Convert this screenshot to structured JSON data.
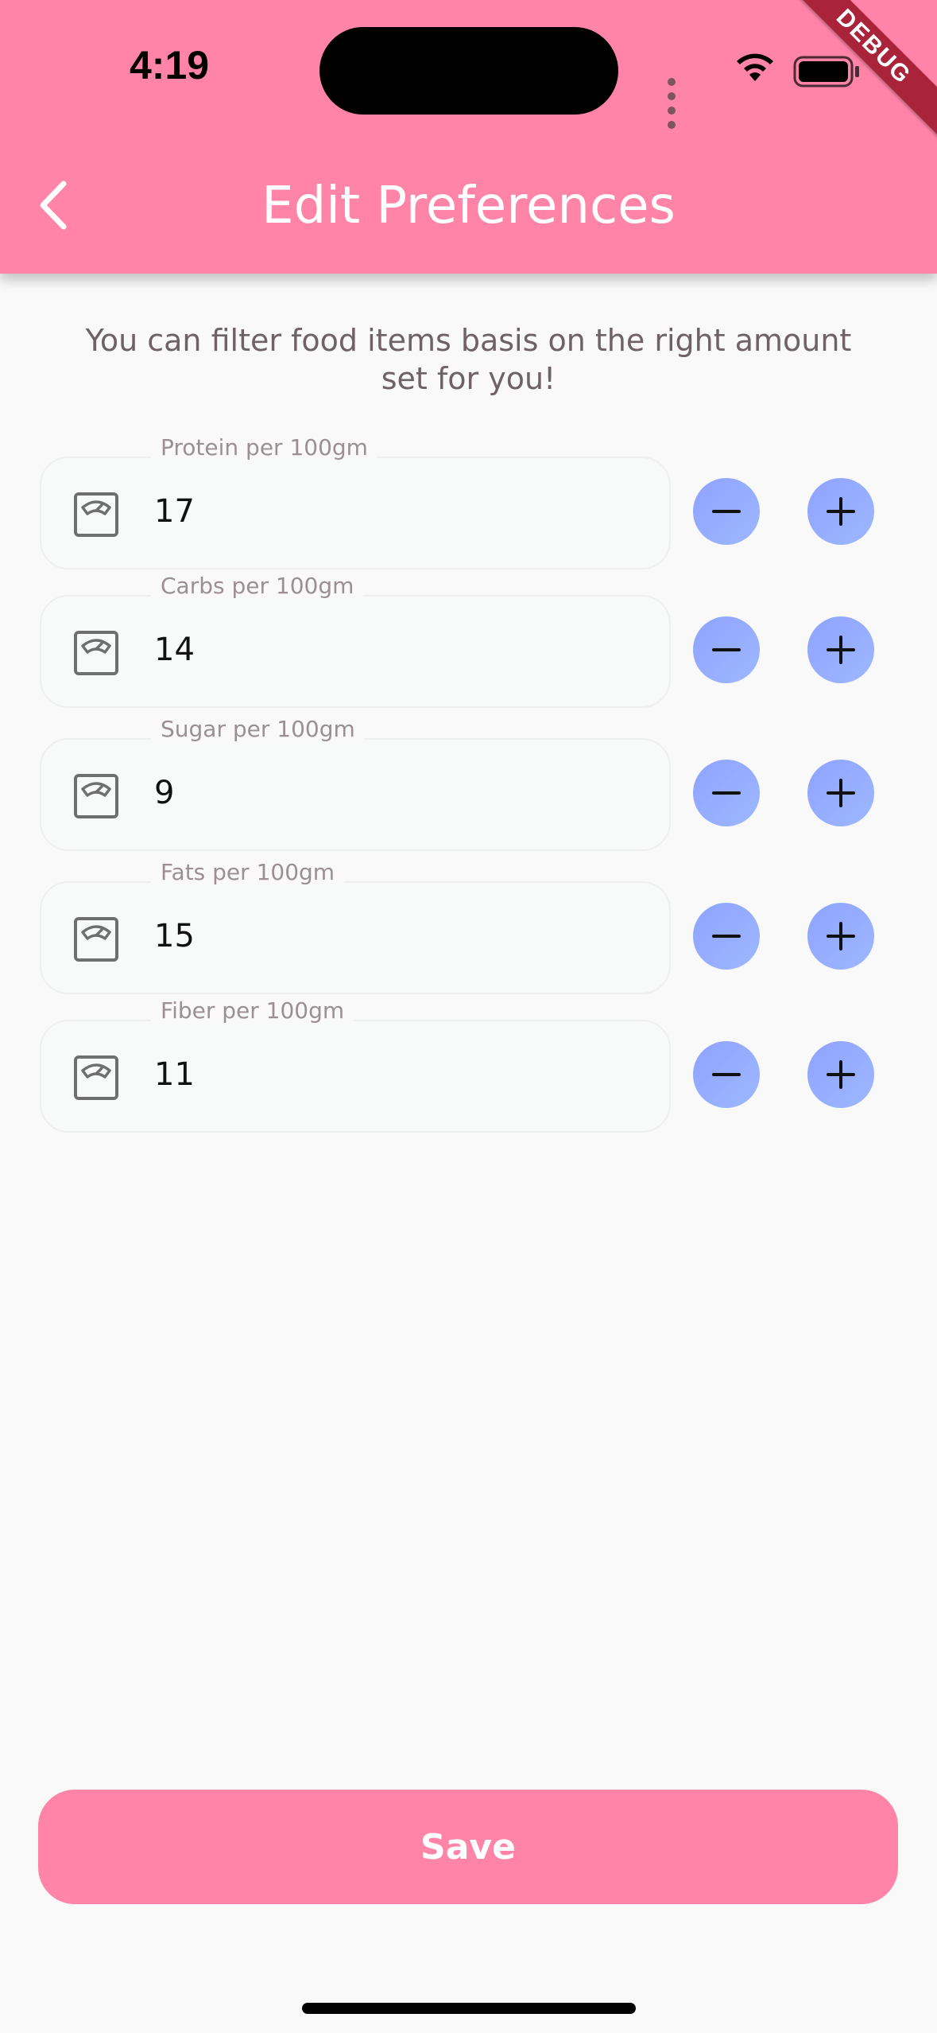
{
  "status_bar": {
    "time": "4:19"
  },
  "debug_banner": "DEBUG",
  "header": {
    "title": "Edit Preferences"
  },
  "subtitle": "You can filter food items basis on the right amount set for you!",
  "fields": [
    {
      "label": "Protein per 100gm",
      "value": "17"
    },
    {
      "label": "Carbs per 100gm",
      "value": "14"
    },
    {
      "label": "Sugar per 100gm",
      "value": "9"
    },
    {
      "label": "Fats per 100gm",
      "value": "15"
    },
    {
      "label": "Fiber per 100gm",
      "value": "11"
    }
  ],
  "icons": {
    "back": "chevron-left-icon",
    "field": "scale-icon",
    "decrement": "minus-icon",
    "increment": "plus-icon"
  },
  "colors": {
    "primary": "#ff84a7",
    "stepper": "#96adff",
    "debug": "#a9233b"
  },
  "save_label": "Save"
}
